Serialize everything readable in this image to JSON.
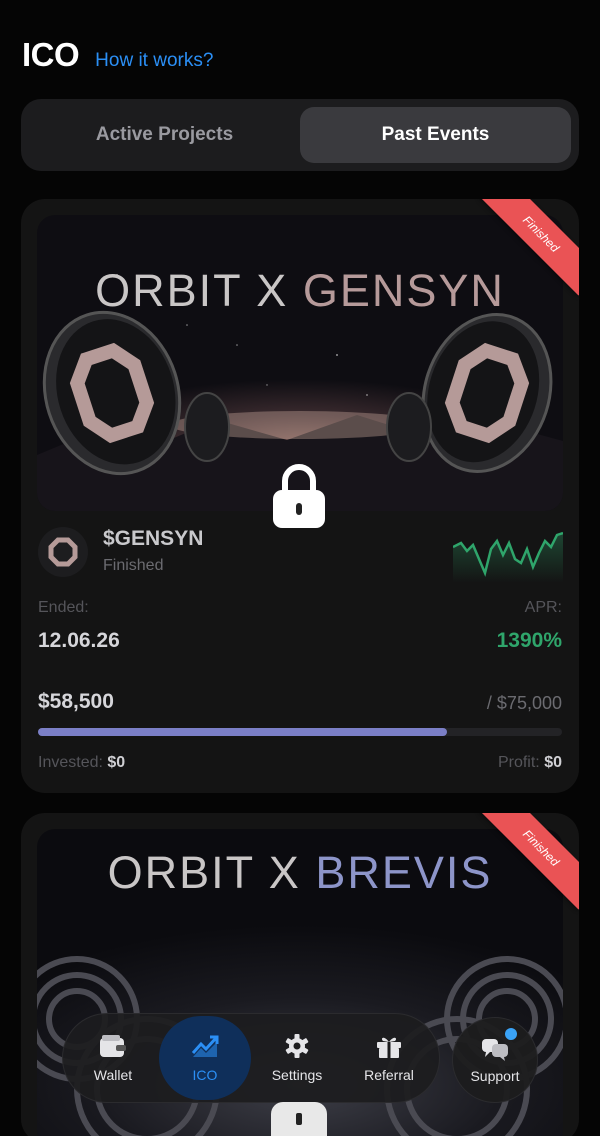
{
  "header": {
    "title": "ICO",
    "how_link": "How it works?"
  },
  "segment": {
    "tabs": [
      "Active Projects",
      "Past Events"
    ],
    "selected": "Past Events"
  },
  "cards": [
    {
      "banner_title_left": "ORBIT X",
      "banner_title_right": "GENSYN",
      "ribbon": "Finished",
      "token": "$GENSYN",
      "status": "Finished",
      "ended_label": "Ended:",
      "ended_value": "12.06.26",
      "apr_label": "APR:",
      "apr_value": "1390%",
      "raised": "$58,500",
      "goal": "/ $75,000",
      "progress": 0.78,
      "invested_label": "Invested:",
      "invested_value": "$0",
      "profit_label": "Profit:",
      "profit_value": "$0"
    },
    {
      "banner_title_left": "ORBIT X",
      "banner_title_right": "BREVIS",
      "ribbon": "Finished"
    }
  ],
  "nav": {
    "items": [
      {
        "label": "Wallet",
        "icon": "wallet-icon"
      },
      {
        "label": "ICO",
        "icon": "chart-up-icon"
      },
      {
        "label": "Settings",
        "icon": "gear-icon"
      },
      {
        "label": "Referral",
        "icon": "gift-icon"
      }
    ],
    "active": "ICO",
    "support_label": "Support"
  },
  "colors": {
    "accent": "#2b8ff5",
    "apr_green": "#2fa56b",
    "ribbon": "#ea5355",
    "progress": "#7b7fc6"
  }
}
